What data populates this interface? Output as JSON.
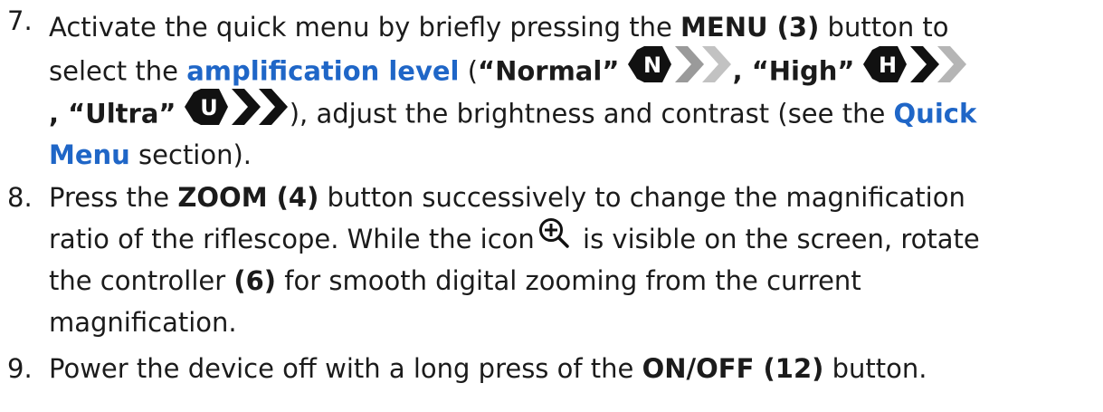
{
  "steps": [
    {
      "number": "7.",
      "lines": {
        "l1_a": "Activate the quick menu by briefly pressing the ",
        "l1_b": "MENU (3)",
        "l1_c": " button to",
        "l2_a": "select the ",
        "l2_link": "amplification level",
        "l2_b": " (",
        "l2_normal": "“Normal”",
        "l2_comma": ",",
        "l2_high": " “High”",
        "l3_comma": ", ",
        "l3_ultra": "“Ultra”",
        "l3_rest": "), adjust the brightness and contrast (see the ",
        "l3_link": "Quick",
        "l4_link": "Menu",
        "l4_rest": " section)."
      },
      "icons": {
        "normal": "N",
        "high": "H",
        "ultra": "U"
      }
    },
    {
      "number": "8.",
      "lines": {
        "l1_a": "Press the ",
        "l1_b": "ZOOM (4)",
        "l1_c": " button successively to change the magnification",
        "l2_a": "ratio of the riflescope. While the icon",
        "l2_b": " is visible on the screen, rotate",
        "l3_a": "the controller ",
        "l3_b": "(6)",
        "l3_c": " for smooth digital zooming from the current",
        "l4_a": "magnification."
      }
    },
    {
      "number": "9.",
      "lines": {
        "l1_a": "Power the device off with a long press of the ",
        "l1_b": "ON/OFF (12)",
        "l1_c": " button."
      }
    }
  ],
  "colors": {
    "text": "#1b1b1b",
    "link": "#1f66c7"
  },
  "icon_names": [
    "amplification-normal-icon",
    "amplification-high-icon",
    "amplification-ultra-icon",
    "zoom-in-icon"
  ]
}
